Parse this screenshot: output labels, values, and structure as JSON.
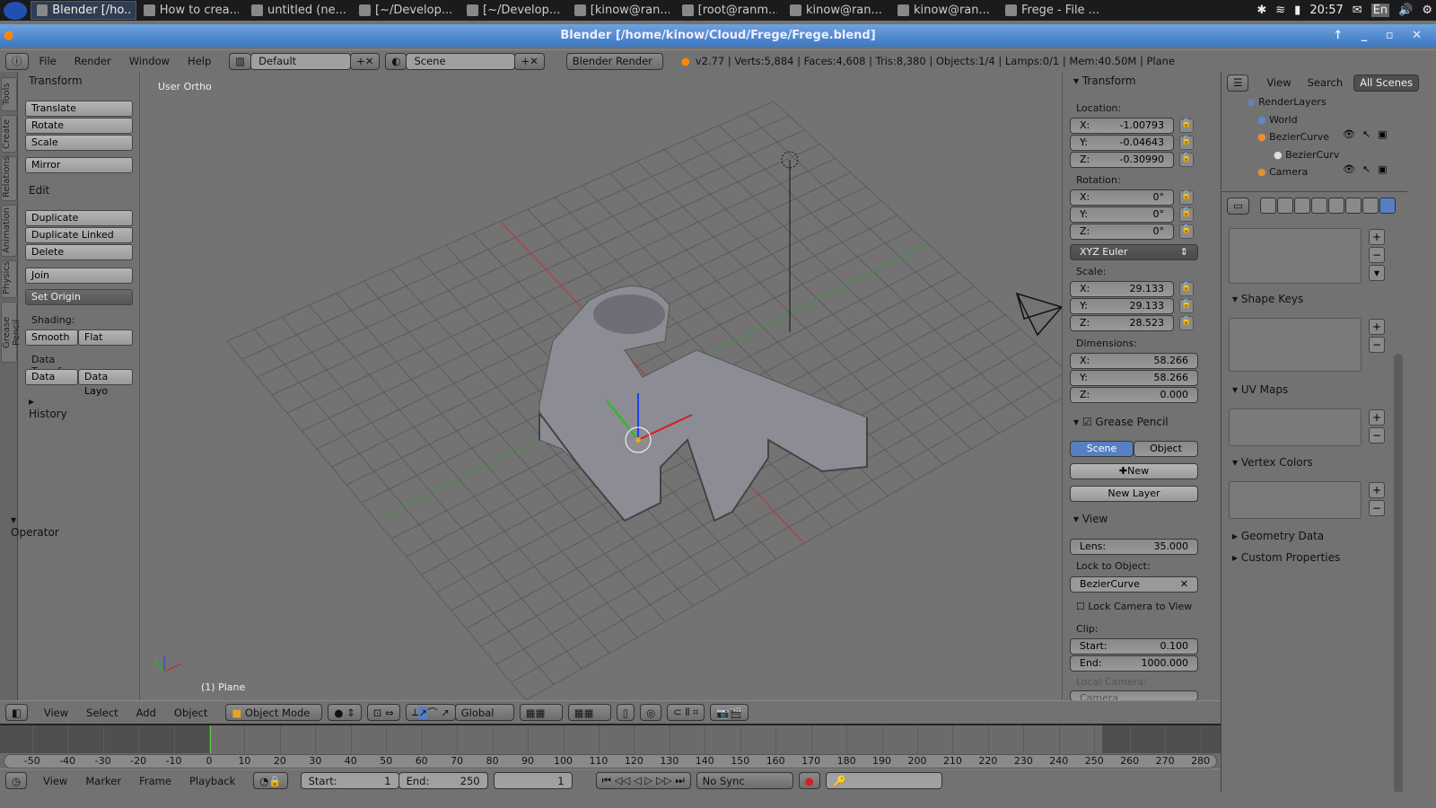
{
  "taskbar": {
    "tasks": [
      "Blender [/ho...",
      "How to crea...",
      "untitled (ne...",
      "[~/Develop...",
      "[~/Develop...",
      "[kinow@ran...",
      "[root@ranm...",
      "kinow@ran...",
      "kinow@ran...",
      "Frege - File ..."
    ],
    "clock": "20:57",
    "lang": "En"
  },
  "window": {
    "title": "Blender [/home/kinow/Cloud/Frege/Frege.blend]"
  },
  "info": {
    "menus": [
      "File",
      "Render",
      "Window",
      "Help"
    ],
    "layout": "Default",
    "scene": "Scene",
    "engine": "Blender Render",
    "stats": "v2.77 | Verts:5,884 | Faces:4,608 | Tris:8,380 | Objects:1/4 | Lamps:0/1 | Mem:40.50M | Plane"
  },
  "tools": {
    "tabs": [
      "Tools",
      "Create",
      "Relations",
      "Animation",
      "Physics",
      "Grease Pencil"
    ],
    "transform_title": "Transform",
    "translate": "Translate",
    "rotate": "Rotate",
    "scale": "Scale",
    "mirror": "Mirror",
    "edit_title": "Edit",
    "duplicate": "Duplicate",
    "duplicate_linked": "Duplicate Linked",
    "delete": "Delete",
    "join": "Join",
    "set_origin": "Set Origin",
    "shading_label": "Shading:",
    "smooth": "Smooth",
    "flat": "Flat",
    "data_transfer_label": "Data Transfer:",
    "data": "Data",
    "data_layo": "Data Layo",
    "history": "History",
    "operator": "Operator"
  },
  "viewport": {
    "view_label": "User Ortho",
    "object_label": "(1) Plane",
    "colors": {
      "x_axis": "#c83232",
      "y_axis": "#3c963c",
      "grid": "#5c5c5c"
    }
  },
  "npanel": {
    "transform": "Transform",
    "location": "Location:",
    "loc": [
      {
        "a": "X:",
        "v": "-1.00793"
      },
      {
        "a": "Y:",
        "v": "-0.04643"
      },
      {
        "a": "Z:",
        "v": "-0.30990"
      }
    ],
    "rotation": "Rotation:",
    "rot": [
      {
        "a": "X:",
        "v": "0°"
      },
      {
        "a": "Y:",
        "v": "0°"
      },
      {
        "a": "Z:",
        "v": "0°"
      }
    ],
    "rot_mode": "XYZ Euler",
    "scale": "Scale:",
    "scl": [
      {
        "a": "X:",
        "v": "29.133"
      },
      {
        "a": "Y:",
        "v": "29.133"
      },
      {
        "a": "Z:",
        "v": "28.523"
      }
    ],
    "dimensions": "Dimensions:",
    "dim": [
      {
        "a": "X:",
        "v": "58.266"
      },
      {
        "a": "Y:",
        "v": "58.266"
      },
      {
        "a": "Z:",
        "v": "0.000"
      }
    ],
    "grease_pencil": "Grease Pencil",
    "gp_scene": "Scene",
    "gp_object": "Object",
    "gp_new": "New",
    "gp_new_layer": "New Layer",
    "view": "View",
    "lens_label": "Lens:",
    "lens": "35.000",
    "lock_to_object": "Lock to Object:",
    "lock_obj": "BezierCurve",
    "lock_camera": "Lock Camera to View",
    "clip": "Clip:",
    "clip_start_label": "Start:",
    "clip_start": "0.100",
    "clip_end_label": "End:",
    "clip_end": "1000.000",
    "local_camera": "Local Camera:",
    "local_camera_value": "Camera"
  },
  "outliner": {
    "view": "View",
    "search": "Search",
    "filter": "All Scenes",
    "rows": [
      "RenderLayers",
      "World",
      "BezierCurve",
      "BezierCurv",
      "Camera"
    ]
  },
  "props": {
    "panels": [
      "Shape Keys",
      "UV Maps",
      "Vertex Colors",
      "Geometry Data",
      "Custom Properties"
    ]
  },
  "header3d": {
    "menus": [
      "View",
      "Select",
      "Add",
      "Object"
    ],
    "mode": "Object Mode",
    "orientation": "Global"
  },
  "timeline": {
    "ticks": [
      -50,
      -40,
      -30,
      -20,
      -10,
      0,
      10,
      20,
      30,
      40,
      50,
      60,
      70,
      80,
      90,
      100,
      110,
      120,
      130,
      140,
      150,
      160,
      170,
      180,
      190,
      200,
      210,
      220,
      230,
      240,
      250,
      260,
      270,
      280
    ],
    "current_frame": 1
  },
  "timeheader": {
    "menus": [
      "View",
      "Marker",
      "Frame",
      "Playback"
    ],
    "start_label": "Start:",
    "start": "1",
    "end_label": "End:",
    "end": "250",
    "frame": "1",
    "sync": "No Sync"
  }
}
